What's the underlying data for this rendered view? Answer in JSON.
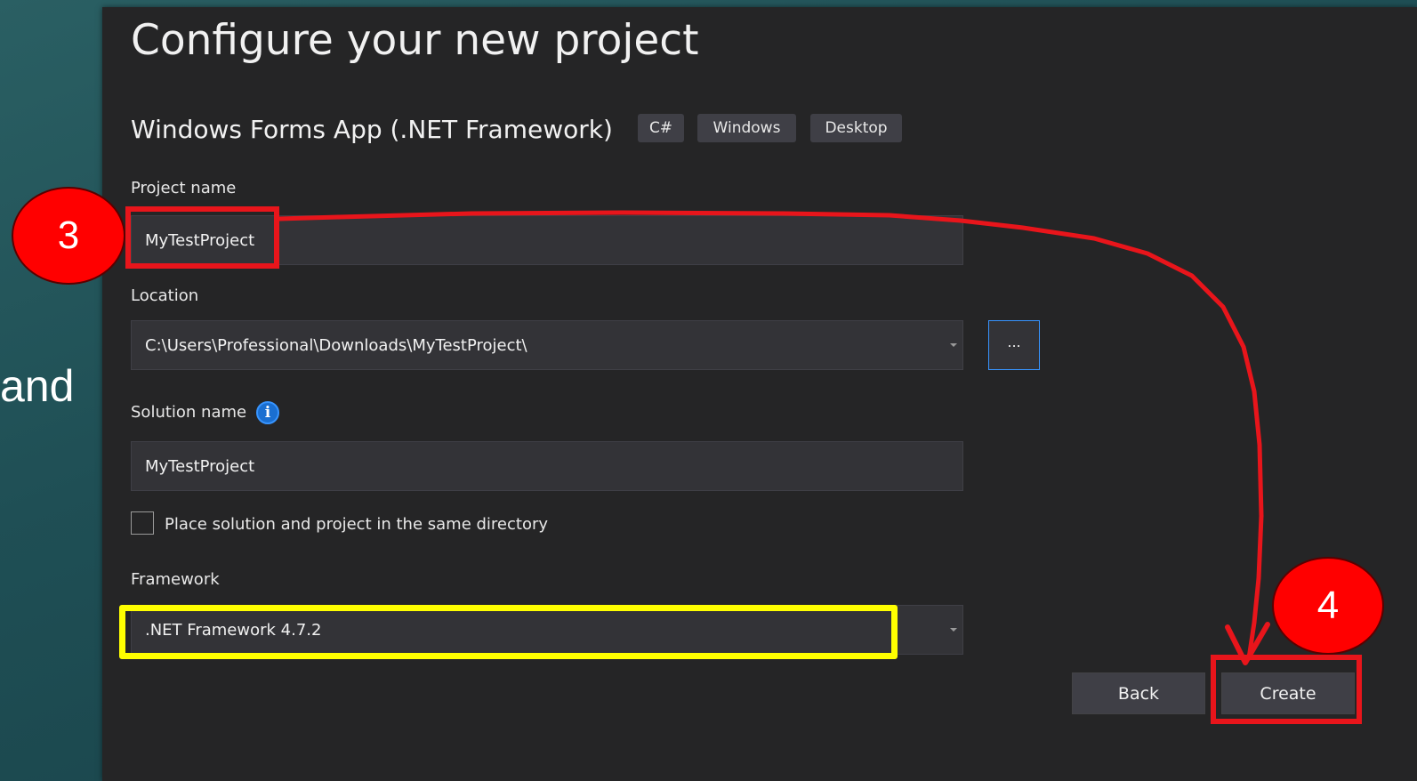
{
  "slide": {
    "partial_text": "and"
  },
  "dialog": {
    "title": "Configure your new project",
    "template": {
      "name": "Windows Forms App (.NET Framework)",
      "tags": [
        "C#",
        "Windows",
        "Desktop"
      ]
    },
    "project_name": {
      "label": "Project name",
      "value": "MyTestProject"
    },
    "location": {
      "label": "Location",
      "value": "C:\\Users\\Professional\\Downloads\\MyTestProject\\",
      "browse_label": "..."
    },
    "solution_name": {
      "label": "Solution name",
      "value": "MyTestProject",
      "info_icon": "info-icon"
    },
    "same_directory": {
      "label": "Place solution and project in the same directory",
      "checked": false
    },
    "framework": {
      "label": "Framework",
      "value": ".NET Framework 4.7.2"
    },
    "buttons": {
      "back": "Back",
      "create": "Create"
    }
  },
  "annotations": {
    "step_3": "3",
    "step_4": "4",
    "colors": {
      "callout": "#ff0000",
      "highlight_red": "#e8151b",
      "highlight_yellow": "#ffff00"
    }
  }
}
